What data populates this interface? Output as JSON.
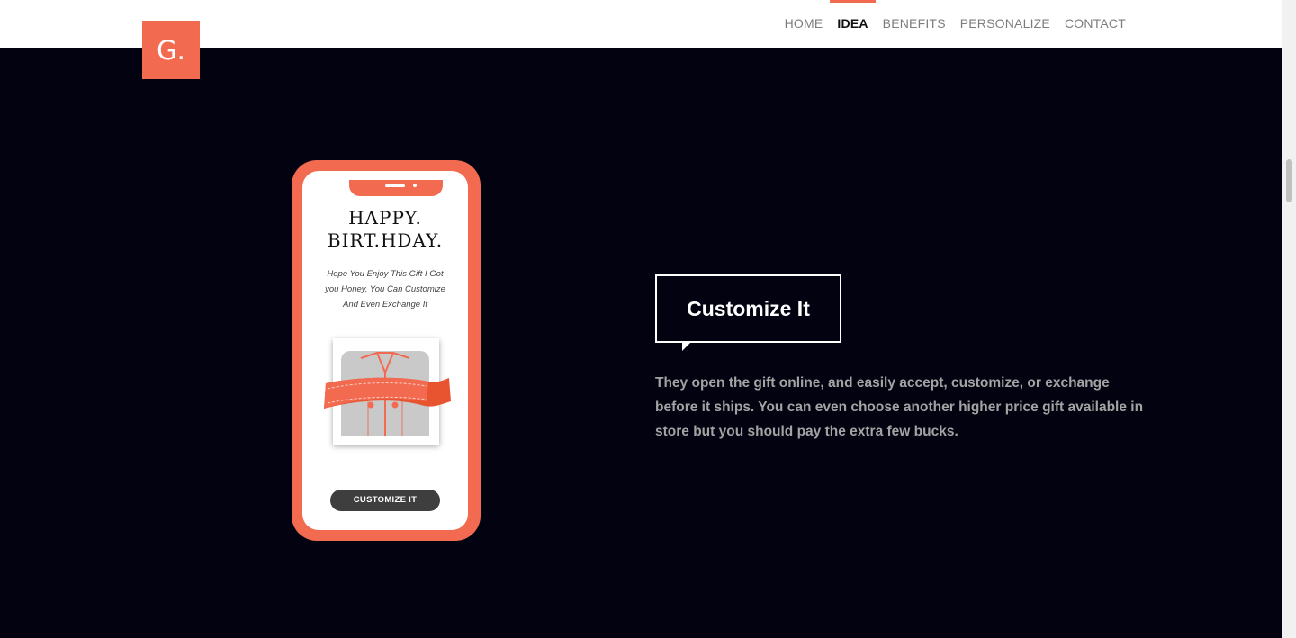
{
  "header": {
    "logo_text": "G.",
    "nav": [
      {
        "label": "HOME",
        "active": false
      },
      {
        "label": "IDEA",
        "active": true
      },
      {
        "label": "BENEFITS",
        "active": false
      },
      {
        "label": "PERSONALIZE",
        "active": false
      },
      {
        "label": "CONTACT",
        "active": false
      }
    ]
  },
  "phone": {
    "card_title_line1": "HAPPY.",
    "card_title_line2": "BIRT.HDAY.",
    "card_message": "Hope You Enjoy This Gift I Got you Honey, You Can Customize And Even Exchange It",
    "button_label": "CUSTOMIZE IT"
  },
  "section": {
    "heading": "Customize It",
    "description": "They open the gift online, and easily accept, customize, or exchange before it ships. You can even choose another higher price gift available in store but you should pay the extra few bucks."
  },
  "colors": {
    "accent": "#f26b50",
    "background_dark": "#020210",
    "text_muted": "#a3a3a3"
  }
}
